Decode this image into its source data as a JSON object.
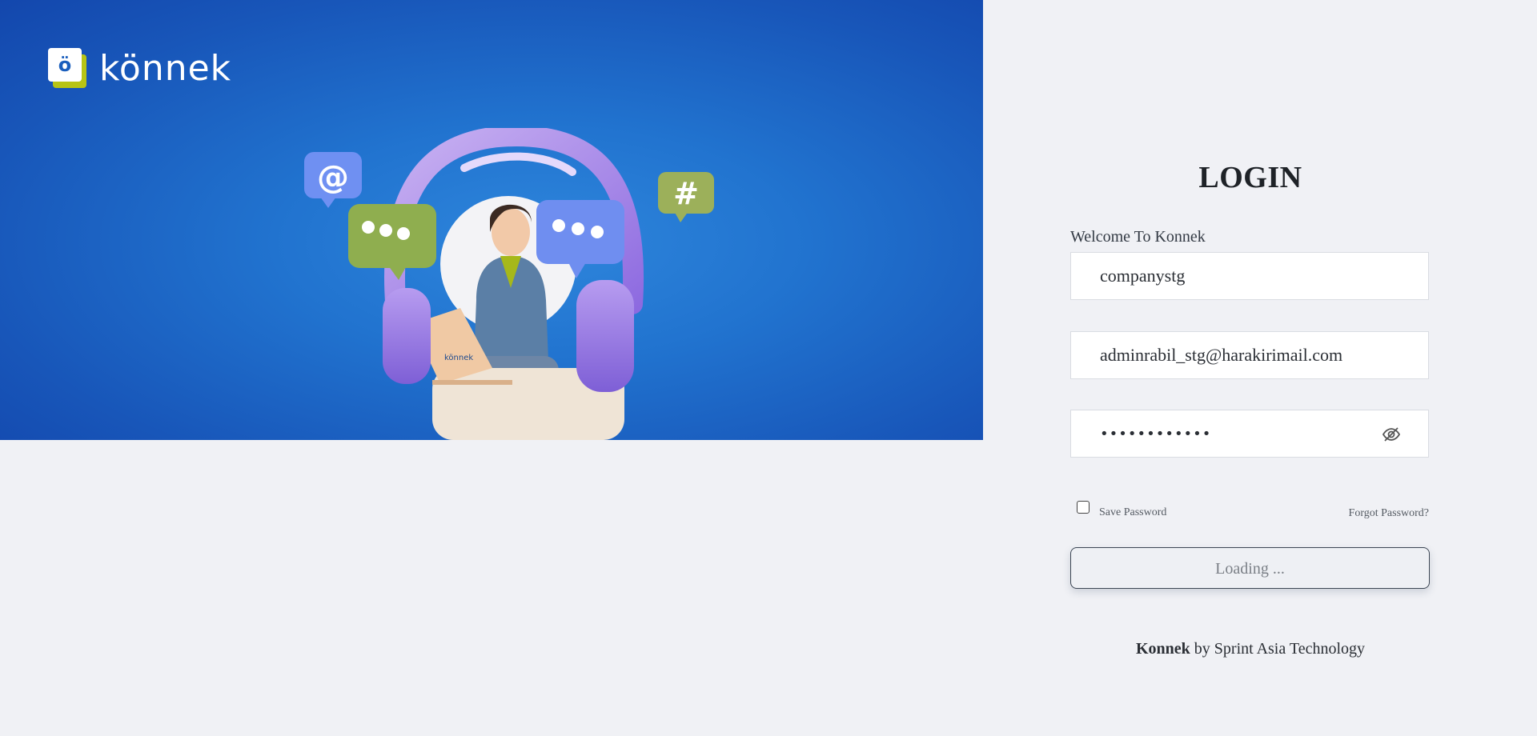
{
  "brand": {
    "logo_glyph": "ö",
    "logo_text": "könnek",
    "colors": {
      "banner_blue": "#1f6fcc",
      "logo_accent": "#b7c414",
      "page_bg": "#f0f1f5"
    }
  },
  "login": {
    "title": "LOGIN",
    "welcome": "Welcome To Konnek",
    "company_value": "companystg",
    "email_value": "adminrabil_stg@harakirimail.com",
    "password_value": "••••••••••••",
    "password_toggle_icon": "eye-slash-icon",
    "save_password_label": "Save Password",
    "save_password_checked": false,
    "forgot_password_label": "Forgot Password?",
    "submit_label": "Loading ..."
  },
  "illustration": {
    "laptop_label": "könnek"
  },
  "footer": {
    "brand": "Konnek",
    "text": "by Sprint Asia Technology"
  }
}
